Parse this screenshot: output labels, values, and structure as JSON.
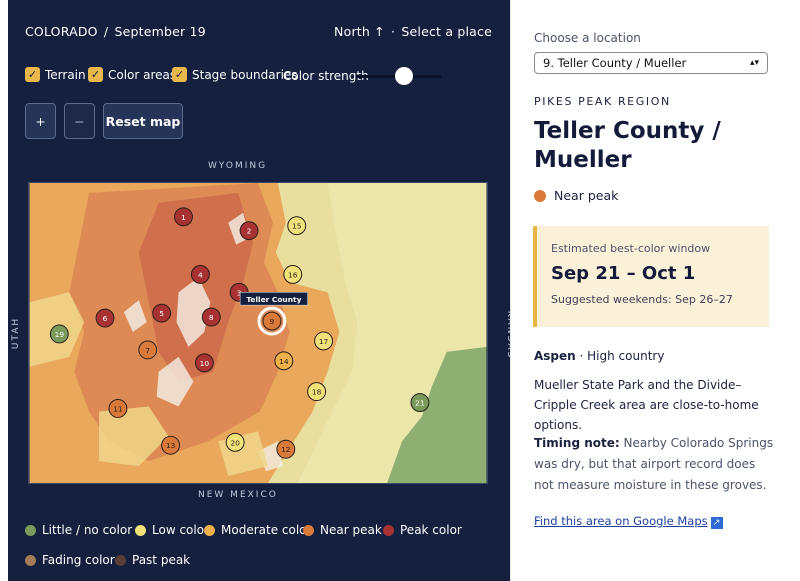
{
  "header": {
    "state": "COLORADO",
    "date": "September 19",
    "hint_north": "North ↑",
    "hint_select": "Select a place"
  },
  "controls": {
    "terrain": "Terrain",
    "color_areas": "Color areas",
    "stage_boundaries": "Stage boundaries",
    "color_strength": "Color strength",
    "color_strength_level": 0.6,
    "zoom_in": "+",
    "zoom_out": "−",
    "reset": "Reset map"
  },
  "map": {
    "edge_north": "WYOMING",
    "edge_south": "NEW MEXICO",
    "edge_west": "UTAH",
    "edge_east": "KANSAS",
    "tooltip": "Teller County",
    "selected": "9",
    "markers": [
      {
        "id": "1",
        "stage": "peak"
      },
      {
        "id": "2",
        "stage": "peak"
      },
      {
        "id": "3",
        "stage": "peak"
      },
      {
        "id": "4",
        "stage": "peak"
      },
      {
        "id": "5",
        "stage": "peak"
      },
      {
        "id": "6",
        "stage": "peak"
      },
      {
        "id": "7",
        "stage": "near"
      },
      {
        "id": "8",
        "stage": "peak"
      },
      {
        "id": "9",
        "stage": "near"
      },
      {
        "id": "10",
        "stage": "peak"
      },
      {
        "id": "11",
        "stage": "near"
      },
      {
        "id": "12",
        "stage": "near"
      },
      {
        "id": "13",
        "stage": "near"
      },
      {
        "id": "14",
        "stage": "moderate"
      },
      {
        "id": "15",
        "stage": "low"
      },
      {
        "id": "16",
        "stage": "low"
      },
      {
        "id": "17",
        "stage": "low"
      },
      {
        "id": "18",
        "stage": "low"
      },
      {
        "id": "19",
        "stage": "little"
      },
      {
        "id": "20",
        "stage": "low"
      },
      {
        "id": "21",
        "stage": "little"
      }
    ]
  },
  "legend": [
    {
      "label": "Little / no color",
      "color": "#7a9b5a"
    },
    {
      "label": "Low color",
      "color": "#efe27a"
    },
    {
      "label": "Moderate color",
      "color": "#eeb04b"
    },
    {
      "label": "Near peak",
      "color": "#d97a3a"
    },
    {
      "label": "Peak color",
      "color": "#a83232"
    },
    {
      "label": "Fading color",
      "color": "#a57c59"
    },
    {
      "label": "Past peak",
      "color": "#5a3e35"
    }
  ],
  "colors": {
    "little": "#7a9b5a",
    "low": "#efe27a",
    "moderate": "#eeb04b",
    "near": "#d97a3a",
    "peak": "#a83232",
    "panel": "#15203f",
    "accent": "#e9b84a"
  },
  "detail": {
    "choose_label": "Choose a location",
    "select_value": "9. Teller County / Mueller",
    "region": "PIKES PEAK REGION",
    "title": "Teller County / Mueller",
    "status": "Near peak",
    "window_label": "Estimated best-color window",
    "window_dates": "Sep 21 – Oct 1",
    "weekends": "Suggested weekends: Sep 26–27",
    "species": "Aspen",
    "species_sep": " · ",
    "habitat": "High country",
    "description": "Mueller State Park and the Divide–Cripple Creek area are close-to-home options.",
    "note_label": "Timing note:",
    "note_text": " Nearby Colorado Springs was dry, but that airport record does not measure moisture in these groves.",
    "link": "Find this area on Google Maps",
    "link_icon": "external-link-icon"
  }
}
